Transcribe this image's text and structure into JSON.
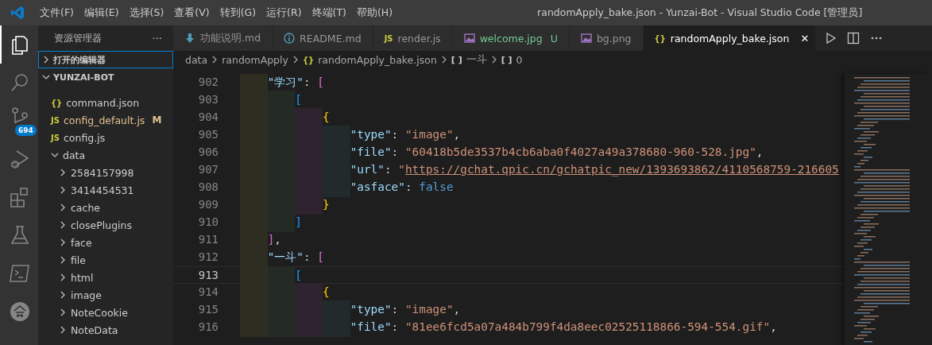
{
  "window": {
    "title": "randomApply_bake.json - Yunzai-Bot - Visual Studio Code [管理员]"
  },
  "menu": [
    "文件(F)",
    "编辑(E)",
    "选择(S)",
    "查看(V)",
    "转到(G)",
    "运行(R)",
    "终端(T)",
    "帮助(H)"
  ],
  "activity_bar": [
    {
      "kind": "explorer",
      "selected": true
    },
    {
      "kind": "search",
      "selected": false
    },
    {
      "kind": "source-control",
      "selected": false,
      "badge": "694"
    },
    {
      "kind": "run-debug",
      "selected": false
    },
    {
      "kind": "extensions",
      "selected": false
    },
    {
      "kind": "testing",
      "selected": false
    },
    {
      "kind": "terminal",
      "selected": false
    },
    {
      "kind": "extension-round",
      "selected": false
    }
  ],
  "sidebar": {
    "title": "资源管理器",
    "more": "···",
    "sections": [
      {
        "label": "打开的编辑器",
        "expanded": false,
        "focused": true
      },
      {
        "label": "YUNZAI-BOT",
        "expanded": true,
        "focused": false
      }
    ],
    "tree": [
      {
        "name": "command.json",
        "kind": "json",
        "glyph": "{}",
        "modified": false
      },
      {
        "name": "config_default.js",
        "kind": "js",
        "glyph": "JS",
        "modified": true,
        "badge": "M"
      },
      {
        "name": "config.js",
        "kind": "js",
        "glyph": "JS",
        "modified": false
      },
      {
        "name": "data",
        "kind": "folder",
        "expanded": true,
        "children": [
          {
            "name": "2584157998",
            "kind": "folder",
            "expanded": false
          },
          {
            "name": "3414454531",
            "kind": "folder",
            "expanded": false
          },
          {
            "name": "cache",
            "kind": "folder",
            "expanded": false
          },
          {
            "name": "closePlugins",
            "kind": "folder",
            "expanded": false
          },
          {
            "name": "face",
            "kind": "folder",
            "expanded": false
          },
          {
            "name": "file",
            "kind": "folder",
            "expanded": false
          },
          {
            "name": "html",
            "kind": "folder",
            "expanded": false
          },
          {
            "name": "image",
            "kind": "folder",
            "expanded": false
          },
          {
            "name": "NoteCookie",
            "kind": "folder",
            "expanded": false
          },
          {
            "name": "NoteData",
            "kind": "folder",
            "expanded": false
          }
        ]
      }
    ]
  },
  "tabs": [
    {
      "label": "功能说明.md",
      "kind": "md",
      "selected": false
    },
    {
      "label": "README.md",
      "kind": "info",
      "selected": false
    },
    {
      "label": "render.js",
      "kind": "js",
      "glyph": "JS",
      "selected": false
    },
    {
      "label": "welcome.jpg",
      "kind": "image",
      "selected": false,
      "untracked": true,
      "badge": "U"
    },
    {
      "label": "bg.png",
      "kind": "image",
      "selected": false
    },
    {
      "label": "randomApply_bake.json",
      "kind": "json",
      "glyph": "{}",
      "selected": true,
      "close": "✕"
    }
  ],
  "editor_actions": [
    {
      "kind": "run"
    },
    {
      "kind": "split"
    },
    {
      "kind": "more"
    }
  ],
  "breadcrumbs": [
    {
      "label": "data"
    },
    {
      "label": "randomApply"
    },
    {
      "label": "randomApply_bake.json",
      "kind": "json",
      "glyph": "{}"
    },
    {
      "label": "一斗",
      "kind": "array",
      "glyph": "[ ]"
    },
    {
      "label": "0",
      "kind": "array",
      "glyph": "[ ]"
    }
  ],
  "code": [
    {
      "number": "902",
      "text": "    \"学习\": [",
      "current": false
    },
    {
      "number": "903",
      "text": "        [",
      "current": false
    },
    {
      "number": "904",
      "text": "            {",
      "current": false
    },
    {
      "number": "905",
      "text": "                \"type\": \"image\",",
      "current": false,
      "link": false
    },
    {
      "number": "906",
      "text": "                \"file\": \"60418b5de3537b4cb6aba0f4027a49a378680-960-528.jpg\",",
      "current": false,
      "link": false
    },
    {
      "number": "907",
      "text": "                \"url\": \"https://gchat.qpic.cn/gchatpic_new/1393693862/4110568759-216605",
      "current": false,
      "link": true
    },
    {
      "number": "908",
      "text": "                \"asface\": false",
      "current": false
    },
    {
      "number": "909",
      "text": "            }",
      "current": false
    },
    {
      "number": "910",
      "text": "        ]",
      "current": false
    },
    {
      "number": "911",
      "text": "    ],",
      "current": false
    },
    {
      "number": "912",
      "text": "    \"一斗\": [",
      "current": false
    },
    {
      "number": "913",
      "text": "        [",
      "current": true
    },
    {
      "number": "914",
      "text": "            {",
      "current": false
    },
    {
      "number": "915",
      "text": "                \"type\": \"image\",",
      "current": false,
      "link": false
    },
    {
      "number": "916",
      "text": "                \"file\": \"81ee6fcd5a07a484b799f4da8eec02525118866-594-554.gif\",",
      "current": false,
      "link": false
    }
  ]
}
